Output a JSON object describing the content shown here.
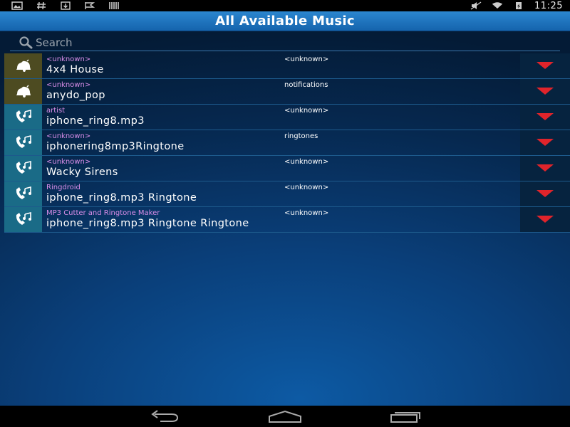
{
  "status_bar": {
    "left_icons": [
      "photo-icon",
      "hash-icon",
      "download-icon",
      "flag-icon",
      "barcode-icon"
    ],
    "right_icons": [
      "mute-icon",
      "wifi-icon",
      "battery-icon"
    ],
    "time": "11:25"
  },
  "header": {
    "title": "All Available Music"
  },
  "search": {
    "placeholder": "Search",
    "value": ""
  },
  "items": [
    {
      "type": "notification",
      "artist": "<unknown>",
      "album": "<unknown>",
      "title": "4x4 House"
    },
    {
      "type": "notification",
      "artist": "<unknown>",
      "album": "notifications",
      "title": "anydo_pop"
    },
    {
      "type": "ringtone",
      "artist": "artist",
      "album": "<unknown>",
      "title": "iphone_ring8.mp3"
    },
    {
      "type": "ringtone",
      "artist": "<unknown>",
      "album": "ringtones",
      "title": "iphonering8mp3Ringtone"
    },
    {
      "type": "ringtone",
      "artist": "<unknown>",
      "album": "<unknown>",
      "title": "Wacky Sirens"
    },
    {
      "type": "ringtone",
      "artist": "Ringdroid",
      "album": "<unknown>",
      "title": "iphone_ring8.mp3 Ringtone"
    },
    {
      "type": "ringtone",
      "artist": "MP3 Cutter and Ringtone Maker",
      "album": "<unknown>",
      "title": "iphone_ring8.mp3 Ringtone Ringtone"
    }
  ],
  "colors": {
    "accent": "#1564ad",
    "artist_text": "#d98de8",
    "menu_arrow": "#e0242b",
    "notification_icon_bg": "#4d4b21",
    "ringtone_icon_bg": "#1a6b87"
  },
  "nav_bar": {
    "buttons": [
      "back-icon",
      "home-icon",
      "recent-apps-icon"
    ]
  }
}
